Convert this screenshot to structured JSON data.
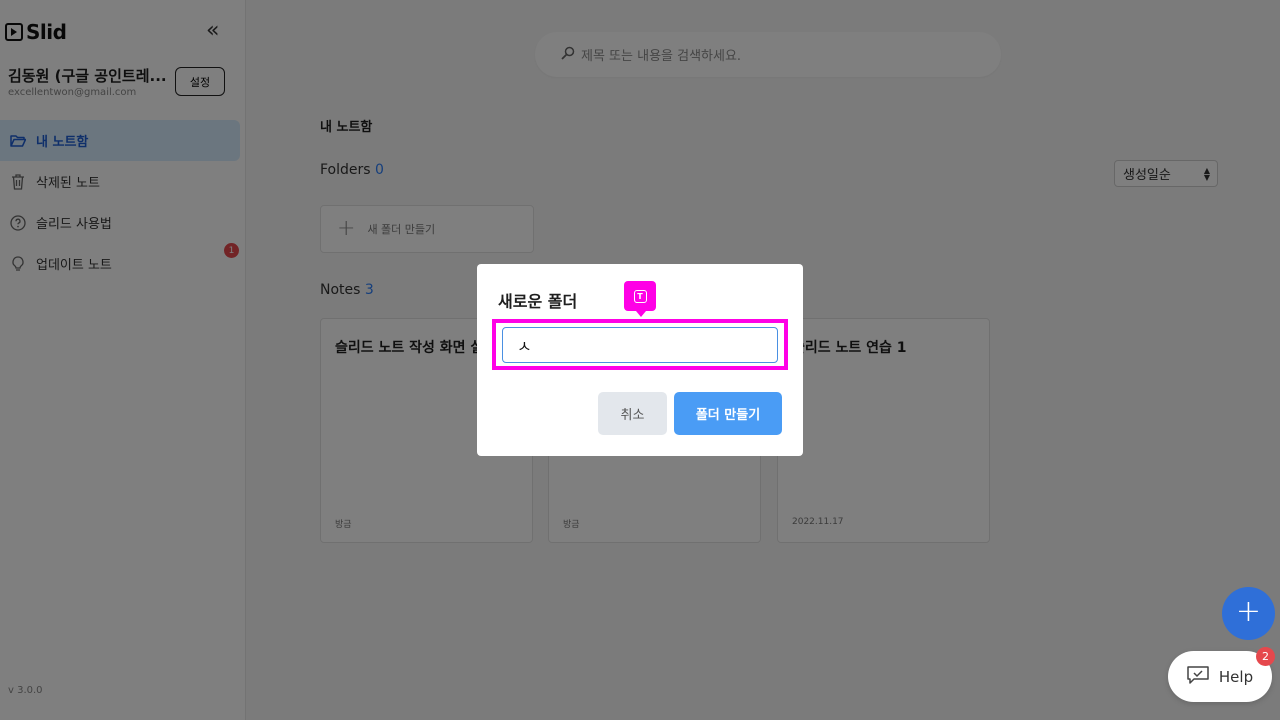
{
  "sidebar": {
    "logo_text": "Slid",
    "collapse_glyph": "«",
    "user_name": "김동원 (구글 공인트레...",
    "user_email": "excellentwon@gmail.com",
    "settings_label": "설정",
    "items": [
      {
        "label": "내 노트함",
        "icon": "folder-open-icon",
        "active": true
      },
      {
        "label": "삭제된 노트",
        "icon": "trash-icon",
        "active": false
      },
      {
        "label": "슬리드 사용법",
        "icon": "question-circle-icon",
        "active": false
      },
      {
        "label": "업데이트 노트",
        "icon": "lightbulb-icon",
        "active": false,
        "badge": "1"
      }
    ],
    "version": "v 3.0.0"
  },
  "main": {
    "search_placeholder": "제목 또는 내용을 검색하세요.",
    "section_title": "내 노트함",
    "folders_label": "Folders",
    "folders_count": "0",
    "sort_value": "생성일순",
    "new_folder_label": "새 폴더 만들기",
    "notes_label": "Notes",
    "notes_count": "3",
    "notes": [
      {
        "title": "슬리드 노트 작성 화면 실",
        "date": "방금"
      },
      {
        "title": "",
        "date": "방금"
      },
      {
        "title": "슬리드 노트 연습 1",
        "date": "2022.11.17"
      }
    ]
  },
  "modal": {
    "title": "새로운 폴더",
    "input_value": "ㅅ",
    "cancel_label": "취소",
    "create_label": "폴더 만들기",
    "type_tag_glyph": "T"
  },
  "fab_glyph": "+",
  "help": {
    "label": "Help",
    "badge": "2"
  },
  "colors": {
    "accent": "#2d7ff9",
    "highlight": "#ff00e6",
    "badge": "#e5484d"
  }
}
